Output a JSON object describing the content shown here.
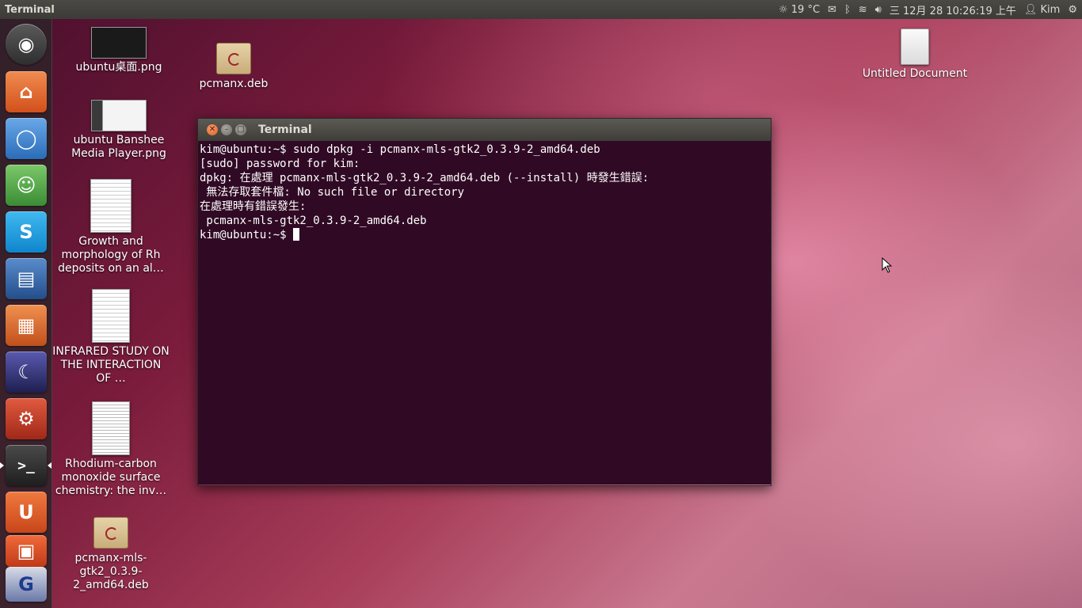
{
  "top_panel": {
    "app_title": "Terminal",
    "weather": "19 °C",
    "datetime": "三 12月 28 10:26:19 上午",
    "user": "Kim"
  },
  "launcher": {
    "items": [
      {
        "name": "dash-home",
        "glyph": "◉",
        "color": "#444"
      },
      {
        "name": "home-folder",
        "glyph": "⌂",
        "color": "#e8662c"
      },
      {
        "name": "chromium",
        "glyph": "◯",
        "color": "#3a7fcf"
      },
      {
        "name": "empathy",
        "glyph": "☺",
        "color": "#4ea24a"
      },
      {
        "name": "skype",
        "glyph": "S",
        "color": "#1c9ce0"
      },
      {
        "name": "libreoffice-writer",
        "glyph": "▤",
        "color": "#2a5e9c"
      },
      {
        "name": "libreoffice-impress",
        "glyph": "▦",
        "color": "#d9662a"
      },
      {
        "name": "shotwell",
        "glyph": "☾",
        "color": "#3c3a7c"
      },
      {
        "name": "system-settings",
        "glyph": "⚙",
        "color": "#c83a2a"
      },
      {
        "name": "terminal",
        "glyph": ">_",
        "color": "#2b2b2b"
      },
      {
        "name": "ubuntu-one",
        "glyph": "U",
        "color": "#e05c24"
      },
      {
        "name": "software-center",
        "glyph": "▣",
        "color": "#d9542a"
      },
      {
        "name": "gnome-disk",
        "glyph": "G",
        "color": "#5a6ea8"
      }
    ]
  },
  "desktop": {
    "icons": [
      {
        "label": "ubuntu桌面.png"
      },
      {
        "label": "ubuntu Banshee Media Player.png"
      },
      {
        "label": "Growth and morphology of Rh deposits on an al…"
      },
      {
        "label": "INFRARED STUDY ON THE INTERACTION OF …"
      },
      {
        "label": "Rhodium-carbon monoxide surface chemistry: the inv…"
      },
      {
        "label": "pcmanx-mls-gtk2_0.3.9-2_amd64.deb"
      },
      {
        "label": "pcmanx.deb"
      },
      {
        "label": "Untitled Document"
      }
    ]
  },
  "terminal": {
    "title": "Terminal",
    "lines": [
      "kim@ubuntu:~$ sudo dpkg -i pcmanx-mls-gtk2_0.3.9-2_amd64.deb",
      "[sudo] password for kim:",
      "dpkg: 在處理 pcmanx-mls-gtk2_0.3.9-2_amd64.deb (--install) 時發生錯誤:",
      " 無法存取套件檔: No such file or directory",
      "在處理時有錯誤發生:",
      " pcmanx-mls-gtk2_0.3.9-2_amd64.deb"
    ],
    "prompt": "kim@ubuntu:~$ "
  }
}
